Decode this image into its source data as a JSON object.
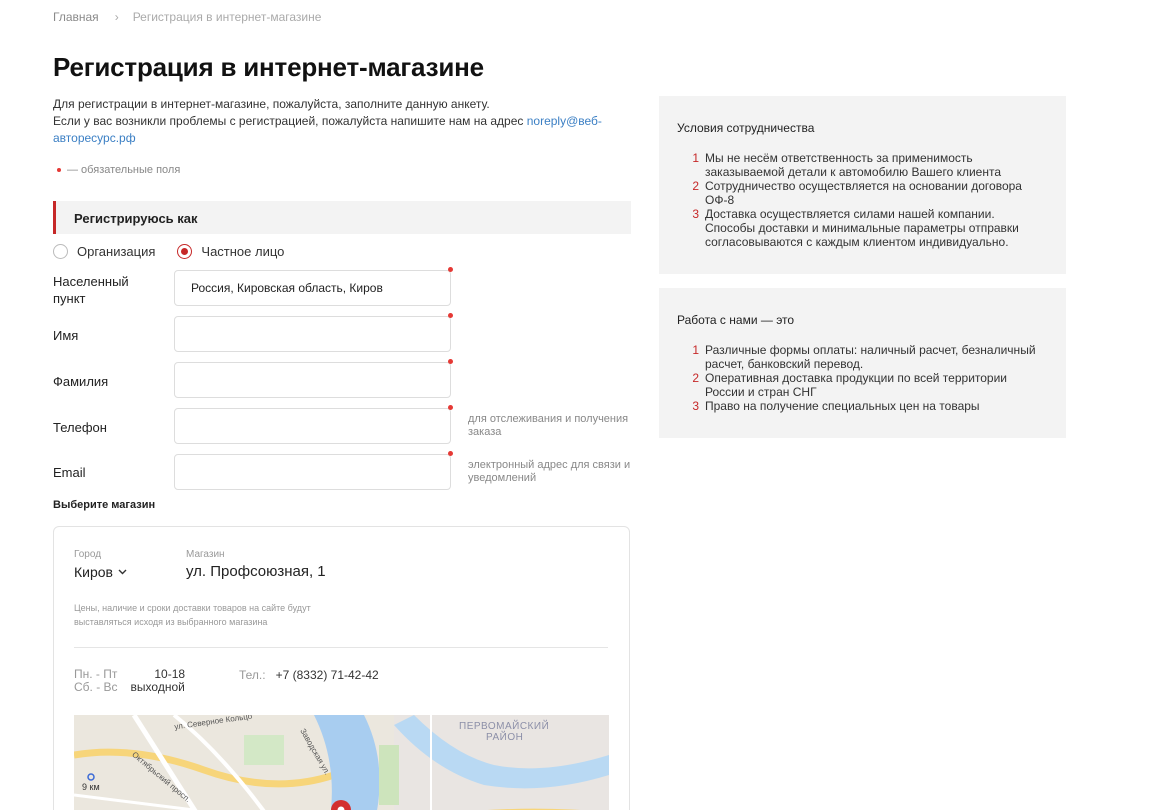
{
  "breadcrumb": {
    "home": "Главная",
    "separator": "›",
    "current": "Регистрация в интернет-магазине"
  },
  "page": {
    "title": "Регистрация в интернет-магазине",
    "intro_line1": "Для регистрации в интернет-магазине, пожалуйста, заполните данную анкету.",
    "intro_line2": "Если у вас возникли проблемы с регистрацией, пожалуйста напишите нам на адрес",
    "email_link": "noreply@веб-авторесурс.рф",
    "required_note": "— обязательные поля"
  },
  "register_as": {
    "heading": "Регистрируюсь как",
    "options": [
      "Организация",
      "Частное лицо"
    ],
    "selected": "Частное лицо"
  },
  "form": {
    "city_label": "Населенный пункт",
    "city_value": "Россия, Кировская область, Киров",
    "name_label": "Имя",
    "name_value": "",
    "surname_label": "Фамилия",
    "surname_value": "",
    "phone_label": "Телефон",
    "phone_value": "",
    "phone_hint": "для отслеживания и получения заказа",
    "email_label": "Email",
    "email_value": "",
    "email_hint": "электронный адрес для связи и уведомлений"
  },
  "store": {
    "section_title": "Выберите магазин",
    "city_caption": "Город",
    "city": "Киров",
    "shop_caption": "Магазин",
    "shop": "ул. Профсоюзная, 1",
    "note": "Цены, наличие и сроки доставки товаров на сайте будут выставляться исходя из выбранного магазина",
    "hours_weekdays_label": "Пн. - Пт",
    "hours_weekdays_value": "10-18",
    "hours_weekend_label": "Сб. - Вс",
    "hours_weekend_value": "выходной",
    "tel_label": "Тел.:",
    "tel_value": "+7 (8332) 71-42-42",
    "map_labels": {
      "district": "ПЕРВОМАЙСКИЙ",
      "district2": "РАЙОН",
      "street1": "ул. Северное Кольцо",
      "street2": "Октябрьский просп.",
      "street3": "Заводская ул.",
      "distance": "9 км"
    }
  },
  "cooperation": {
    "title": "Условия сотрудничества",
    "items": [
      {
        "n": "1",
        "text": "Мы не несём ответственность за применимость заказываемой детали к автомобилю Вашего клиента"
      },
      {
        "n": "2",
        "text": "Сотрудничество осуществляется на основании договора ОФ-8"
      },
      {
        "n": "3",
        "text": "Доставка осуществляется силами нашей компании. Способы доставки и минимальные параметры отправки согласовываются с каждым клиентом индивидуально."
      }
    ]
  },
  "benefits": {
    "title": "Работа с нами — это",
    "items": [
      {
        "n": "1",
        "text": "Различные формы оплаты: наличный расчет, безналичный расчет, банковский перевод."
      },
      {
        "n": "2",
        "text": "Оперативная доставка продукции по всей территории России и стран СНГ"
      },
      {
        "n": "3",
        "text": "Право на получение специальных цен на товары"
      }
    ]
  },
  "colors": {
    "accent": "#c62828",
    "required_dot": "#e53935",
    "link": "#3b7fc4",
    "panel_bg": "#f3f3f3"
  }
}
